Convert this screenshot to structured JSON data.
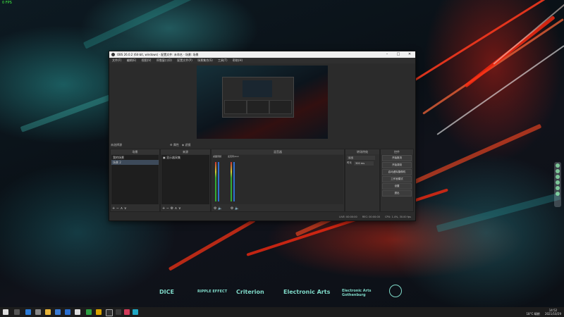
{
  "overlay": {
    "fps": "0 FPS"
  },
  "window": {
    "title": "OBS 26.0.2 (64-bit, windows) - 配置文件: 未命名 - 场景: 场景",
    "menu": [
      "文件(F)",
      "编辑(E)",
      "视图(V)",
      "停靠窗口(D)",
      "配置文件(P)",
      "场景集合(S)",
      "工具(T)",
      "帮助(H)"
    ]
  },
  "preview": {
    "source_text": "未选择源",
    "props_label": "属性",
    "filters_label": "滤镜"
  },
  "docks": {
    "scenes": {
      "title": "场景",
      "items": [
        "我的场景",
        "场景 2"
      ]
    },
    "sources": {
      "title": "来源",
      "items": [
        "显示器采集"
      ]
    },
    "mixer": {
      "title": "混音器",
      "channels": [
        "桌面音频",
        "麦克风/Aux"
      ]
    },
    "transitions": {
      "title": "转场特效",
      "transition": "淡出",
      "duration_label": "时长",
      "duration": "300 ms"
    },
    "controls": {
      "title": "控件",
      "buttons": [
        "开始推流",
        "开始录制",
        "启动虚拟摄像机",
        "工作室模式",
        "设置",
        "退出"
      ]
    }
  },
  "status": {
    "live": "LIVE: 00:00:00",
    "rec": "REC: 00:00:00",
    "cpu": "CPU: 1.4%, 30.00 fps"
  },
  "logos": [
    "DICE",
    "RIPPLE EFFECT",
    "Criterion",
    "Electronic Arts",
    "Electronic Arts Gothenburg"
  ],
  "taskbar": {
    "weather": "18°C 晴朗",
    "time": "14:52",
    "date": "2021/10/29"
  }
}
